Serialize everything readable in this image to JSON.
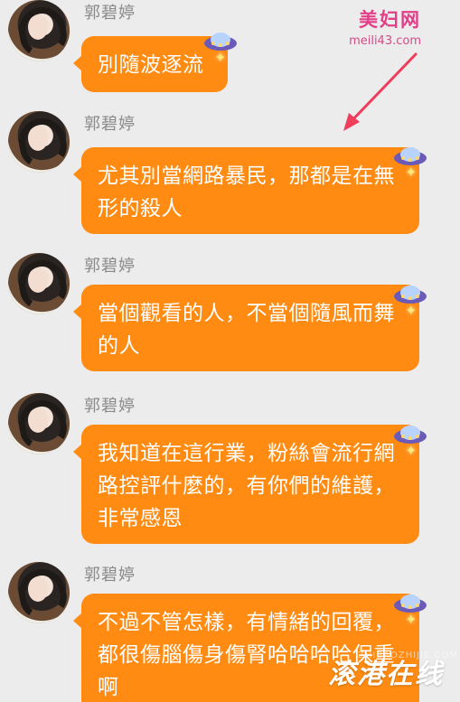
{
  "watermark": {
    "brand": "美妇网",
    "domain": "meili43.com",
    "bottom": "滚港在线",
    "small": "ZHIBAOZHIJIE.COM"
  },
  "messages": [
    {
      "sender": "郭碧婷",
      "text": "別隨波逐流"
    },
    {
      "sender": "郭碧婷",
      "text": "尤其別當網路暴民，那都是在無形的殺人"
    },
    {
      "sender": "郭碧婷",
      "text": "當個觀看的人，不當個隨風而舞的人"
    },
    {
      "sender": "郭碧婷",
      "text": "我知道在這行業，粉絲會流行網路控評什麼的，有你們的維護，非常感恩"
    },
    {
      "sender": "郭碧婷",
      "text": "不過不管怎樣，有情緒的回覆，都很傷腦傷身傷腎哈哈哈哈保重啊"
    }
  ]
}
